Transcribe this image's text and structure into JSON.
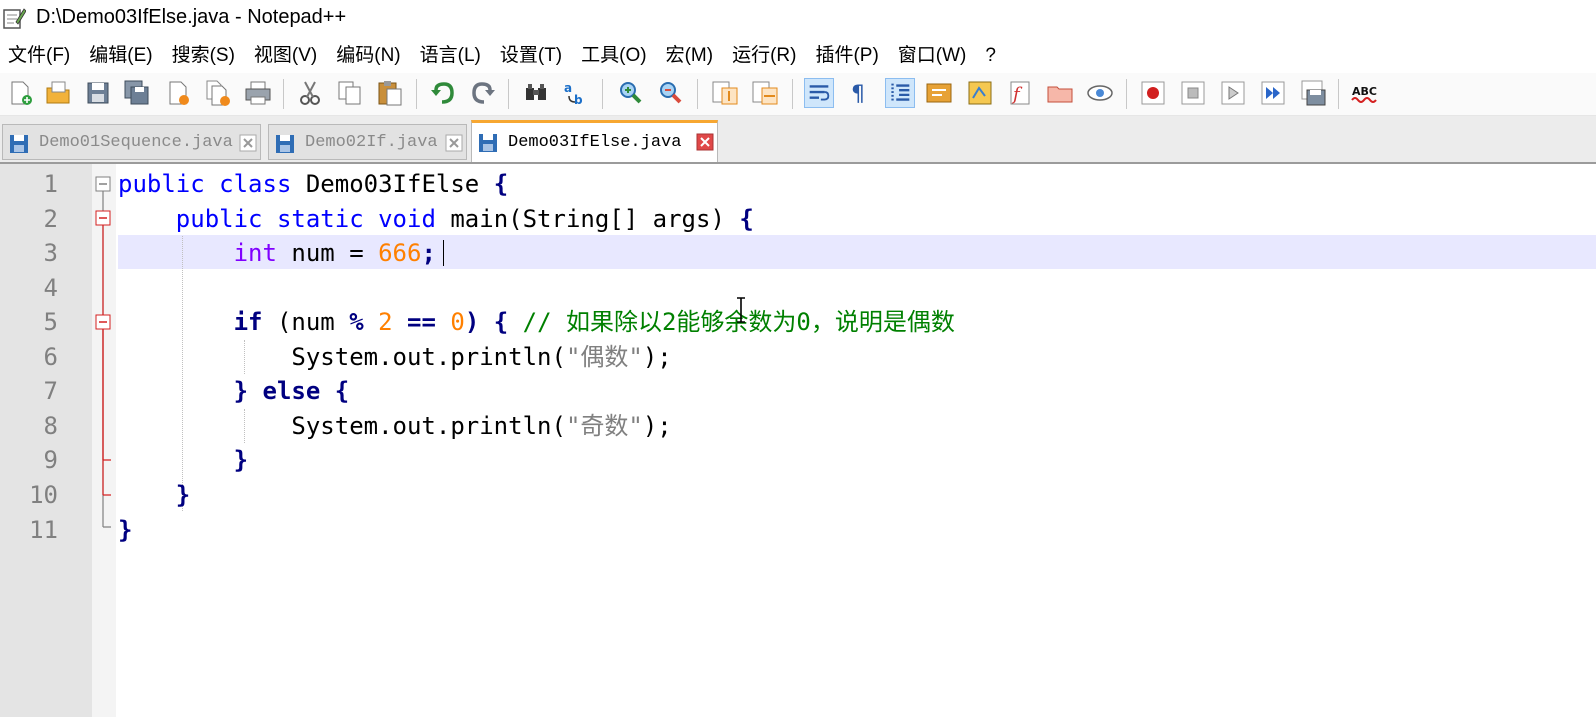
{
  "window": {
    "title": "D:\\Demo03IfElse.java - Notepad++"
  },
  "menu": [
    {
      "label": "文件(F)"
    },
    {
      "label": "编辑(E)"
    },
    {
      "label": "搜索(S)"
    },
    {
      "label": "视图(V)"
    },
    {
      "label": "编码(N)"
    },
    {
      "label": "语言(L)"
    },
    {
      "label": "设置(T)"
    },
    {
      "label": "工具(O)"
    },
    {
      "label": "宏(M)"
    },
    {
      "label": "运行(R)"
    },
    {
      "label": "插件(P)"
    },
    {
      "label": "窗口(W)"
    },
    {
      "label": "?"
    }
  ],
  "toolbar_icons": [
    "new-file-icon",
    "open-file-icon",
    "save-icon",
    "save-all-icon",
    "close-icon",
    "close-all-icon",
    "print-icon",
    "cut-icon",
    "copy-icon",
    "paste-icon",
    "undo-icon",
    "redo-icon",
    "find-icon",
    "replace-icon",
    "zoom-in-icon",
    "zoom-out-icon",
    "sync-vertical-icon",
    "sync-horizontal-icon",
    "word-wrap-icon",
    "show-all-chars-icon",
    "indent-guide-icon",
    "language-icon",
    "document-map-icon",
    "function-list-icon",
    "folder-workspace-icon",
    "monitoring-icon",
    "record-macro-icon",
    "stop-macro-icon",
    "play-macro-icon",
    "run-macro-multiple-icon",
    "save-macro-icon",
    "spell-check-icon"
  ],
  "spellcheck_label": "ABC",
  "tabs": [
    {
      "label": "Demo01Sequence.java",
      "active": false
    },
    {
      "label": "Demo02If.java",
      "active": false
    },
    {
      "label": "Demo03IfElse.java",
      "active": true
    }
  ],
  "editor": {
    "current_line": 3,
    "line_numbers": [
      "1",
      "2",
      "3",
      "4",
      "5",
      "6",
      "7",
      "8",
      "9",
      "10",
      "11"
    ],
    "code": {
      "l1_kw1": "public",
      "l1_kw2": "class",
      "l1_name": "Demo03IfElse",
      "l1_brace": "{",
      "l2_kw1": "public",
      "l2_kw2": "static",
      "l2_kw3": "void",
      "l2_rest": "main(String[] args)",
      "l2_brace": "{",
      "l3_kw": "int",
      "l3_rest": "num =",
      "l3_num": "666",
      "l3_end": ";",
      "l5_kw": "if",
      "l5_p1": "(num",
      "l5_op1": "%",
      "l5_n1": "2",
      "l5_op2": "==",
      "l5_n2": "0",
      "l5_p2": ")",
      "l5_brace": "{",
      "l5_comment": "// 如果除以2能够余数为0，说明是偶数",
      "l6_call": "System.out.println(",
      "l6_str": "\"偶数\"",
      "l6_end": ");",
      "l7_b1": "}",
      "l7_kw": "else",
      "l7_b2": "{",
      "l8_call": "System.out.println(",
      "l8_str": "\"奇数\"",
      "l8_end": ");",
      "l9_b": "}",
      "l10_b": "}",
      "l11_b": "}"
    }
  },
  "colors": {
    "keyword": "#0000ff",
    "type_keyword": "#8000ff",
    "number": "#ff8000",
    "string": "#808080",
    "comment": "#008000",
    "current_line_bg": "#e8e8ff",
    "active_tab_accent": "#f7a731"
  }
}
